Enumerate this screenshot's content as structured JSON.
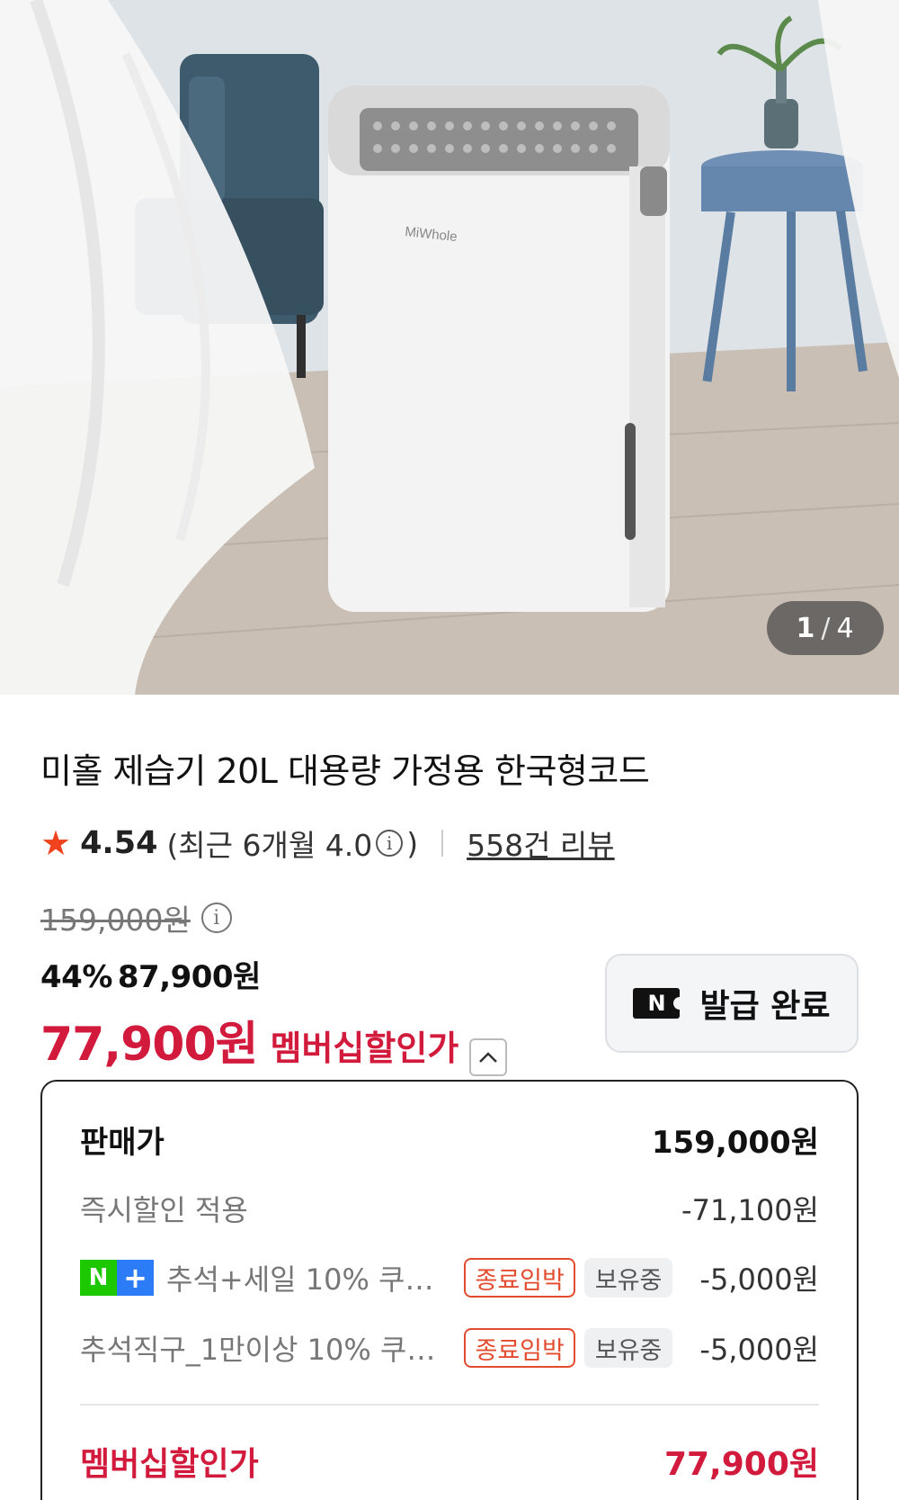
{
  "gallery": {
    "brand_text": "MiWhole",
    "current": "1",
    "separator": "/",
    "total": "4"
  },
  "product": {
    "title": "미홀 제습기 20L 대용량 가정용 한국형코드",
    "rating": "4.54",
    "recent_rating_prefix": "(최근 6개월 4.0",
    "recent_rating_suffix": ")",
    "info_icon": "ⓘ",
    "review_link": "558건 리뷰"
  },
  "price": {
    "original": "159,000원",
    "discount_percent": "44%",
    "sale_price": "87,900원",
    "member_price": "77,900원",
    "member_label": "멤버십할인가",
    "chevron": "^"
  },
  "coupon_button": {
    "logo": "N",
    "label": "발급 완료"
  },
  "breakdown": {
    "rows": [
      {
        "label": "판매가",
        "value": "159,000원"
      },
      {
        "label": "즉시할인 적용",
        "value": "-71,100원"
      },
      {
        "label": "추석+세일 10% 쿠폰 ...",
        "badge_n": "N",
        "badge_plus": "+",
        "tag_expire": "종료임박",
        "tag_owned": "보유중",
        "value": "-5,000원"
      },
      {
        "label": "추석직구_1만이상 10% 쿠폰 ...",
        "tag_expire": "종료임박",
        "tag_owned": "보유중",
        "value": "-5,000원"
      }
    ],
    "total": {
      "label": "멤버십할인가",
      "value": "77,900원"
    }
  },
  "colors": {
    "accent_red": "#d11a3c",
    "star": "#f0421c",
    "tag_red": "#e34b2e",
    "naver_green": "#1ec800",
    "plus_blue": "#2b7cf6"
  }
}
